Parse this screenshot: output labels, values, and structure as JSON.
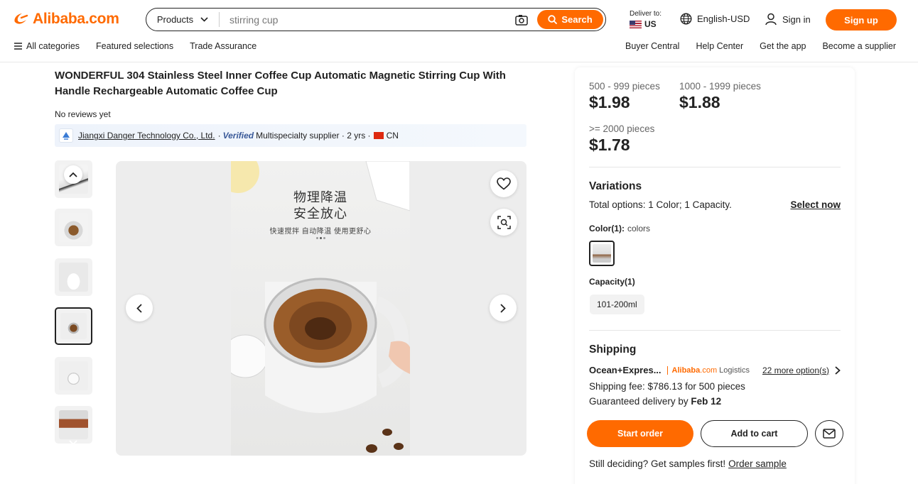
{
  "header": {
    "logo_text": "Alibaba.com",
    "search": {
      "category": "Products",
      "query": "stirring cup",
      "button_label": "Search"
    },
    "deliver": {
      "label": "Deliver to:",
      "country": "US"
    },
    "language": "English-USD",
    "signin": "Sign in",
    "signup": "Sign up",
    "subnav_left": [
      "All categories",
      "Featured selections",
      "Trade Assurance"
    ],
    "subnav_right": [
      "Buyer Central",
      "Help Center",
      "Get the app",
      "Become a supplier"
    ]
  },
  "product": {
    "title": "WONDERFUL 304 Stainless Steel Inner Coffee Cup Automatic Magnetic Stirring Cup With Handle Rechargeable Automatic Coffee Cup",
    "reviews": "No reviews yet",
    "supplier": {
      "name": "Jiangxi Danger Technology Co., Ltd.",
      "verified": "Verified",
      "type": "Multispecialty supplier",
      "years": "2 yrs",
      "country": "CN"
    }
  },
  "gallery": {
    "image_text_line1": "物理降温",
    "image_text_line2": "安全放心",
    "image_text_line3": "快速搅拌 自动降温 使用更舒心",
    "thumb_count": 6,
    "active_thumb": 4
  },
  "pricing": {
    "tiers": [
      {
        "range": "500 - 999 pieces",
        "price": "$1.98"
      },
      {
        "range": "1000 - 1999 pieces",
        "price": "$1.88"
      },
      {
        "range": ">= 2000 pieces",
        "price": "$1.78"
      }
    ]
  },
  "variations": {
    "title": "Variations",
    "total": "Total options: 1 Color; 1 Capacity.",
    "select_now": "Select now",
    "color_label": "Color(1):",
    "color_value": "colors",
    "capacity_label": "Capacity(1)",
    "capacity_option": "101-200ml"
  },
  "shipping": {
    "title": "Shipping",
    "method": "Ocean+Expres...",
    "logistics_brand": "Alibaba",
    "logistics_com": ".com",
    "logistics_suffix": "Logistics",
    "more_options": "22 more option(s)",
    "fee": "Shipping fee: $786.13 for 500 pieces",
    "guaranteed_prefix": "Guaranteed delivery by",
    "guaranteed_date": "Feb 12"
  },
  "actions": {
    "start_order": "Start order",
    "add_to_cart": "Add to cart",
    "samples_text": "Still deciding? Get samples first!",
    "order_sample": "Order sample"
  },
  "colors": {
    "accent": "#ff6a00",
    "text": "#222222"
  }
}
